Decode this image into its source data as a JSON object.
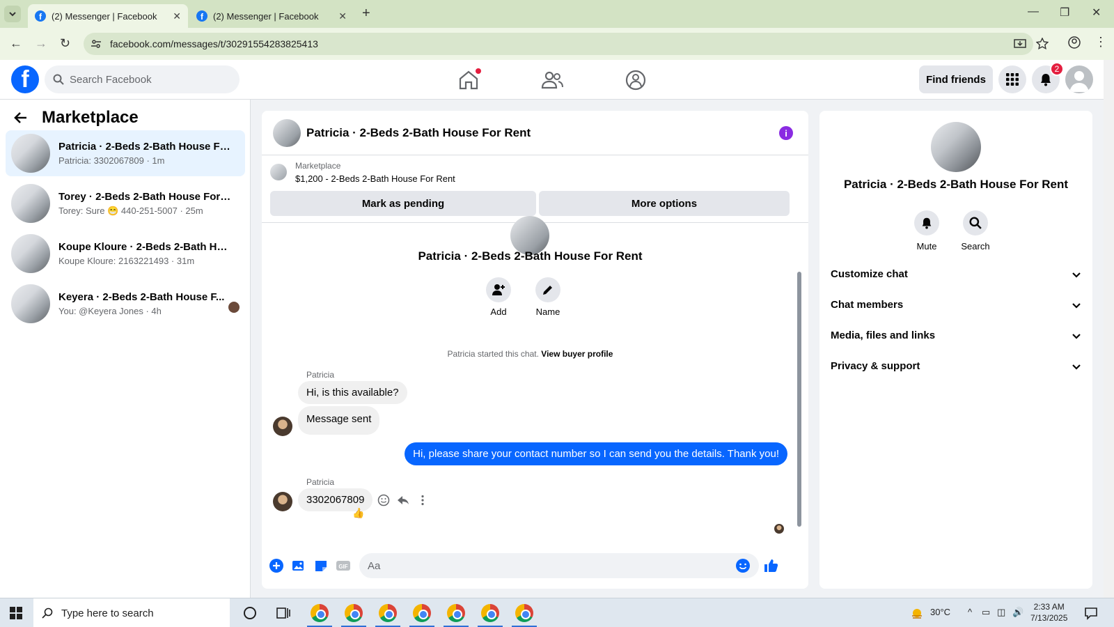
{
  "browser": {
    "tabs": [
      {
        "title": "(2) Messenger | Facebook",
        "active": true
      },
      {
        "title": "(2) Messenger | Facebook",
        "active": false
      }
    ],
    "url": "facebook.com/messages/t/30291554283825413"
  },
  "header": {
    "search_placeholder": "Search Facebook",
    "find_friends": "Find friends",
    "notification_count": "2"
  },
  "sidebar": {
    "title": "Marketplace",
    "conversations": [
      {
        "name": "Patricia · 2-Beds 2-Bath House For ...",
        "snippet": "Patricia: 3302067809 · 1m"
      },
      {
        "name": "Torey · 2-Beds 2-Bath House For R...",
        "snippet": "Torey: Sure 😁 440-251-5007 · 25m"
      },
      {
        "name": "Koupe Kloure · 2-Beds 2-Bath Hou...",
        "snippet": "Koupe Kloure: 2163221493 · 31m"
      },
      {
        "name": "Keyera · 2-Beds 2-Bath House F...",
        "snippet": "You: @Keyera Jones · 4h"
      }
    ]
  },
  "chat": {
    "title": "Patricia · 2-Beds 2-Bath House For Rent",
    "marketplace_label": "Marketplace",
    "listing": "$1,200 - 2-Beds 2-Bath House For Rent",
    "mark_pending": "Mark as pending",
    "more_options": "More options",
    "add_label": "Add",
    "name_label": "Name",
    "started_text": "Patricia started this chat.",
    "view_profile": "View buyer profile",
    "messages": [
      {
        "sender": "Patricia",
        "text": "Hi, is this available?"
      },
      {
        "sender": "",
        "text": "Message sent"
      },
      {
        "sender": "me",
        "text": "Hi, please share your contact number so I can send you the details. Thank you!"
      },
      {
        "sender": "Patricia",
        "text": "3302067809"
      }
    ],
    "composer_placeholder": "Aa"
  },
  "details": {
    "name": "Patricia · 2-Beds 2-Bath House For Rent",
    "mute": "Mute",
    "search": "Search",
    "sections": [
      "Customize chat",
      "Chat members",
      "Media, files and links",
      "Privacy & support"
    ]
  },
  "taskbar": {
    "search_placeholder": "Type here to search",
    "temperature": "30°C",
    "time": "2:33 AM",
    "date": "7/13/2025"
  },
  "colors": {
    "accent": "#0866ff",
    "selected": "#e7f3ff",
    "info": "#8a2be2"
  }
}
